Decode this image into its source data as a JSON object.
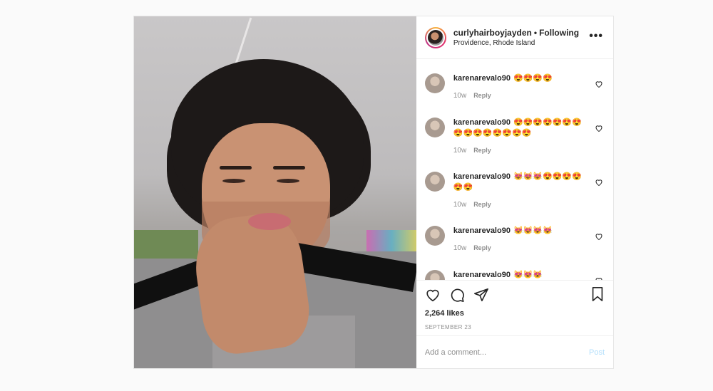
{
  "post": {
    "username": "curlyhairboyjayden",
    "separator": "•",
    "follow_status": "Following",
    "location": "Providence, Rhode Island",
    "more_icon": "more-horizontal-icon",
    "likes": "2,264 likes",
    "date": "SEPTEMBER 23",
    "add_comment_placeholder": "Add a comment...",
    "post_label": "Post"
  },
  "comments": [
    {
      "user": "karenarevalo90",
      "text": "😍😍😍😍",
      "age": "10w",
      "reply": "Reply"
    },
    {
      "user": "karenarevalo90",
      "text": "😍😍😍😍😍😍😍😍😍😍😍😍😍😍😍",
      "age": "10w",
      "reply": "Reply"
    },
    {
      "user": "karenarevalo90",
      "text": "😻😻😻😍😍😍😍😍😍",
      "age": "10w",
      "reply": "Reply"
    },
    {
      "user": "karenarevalo90",
      "text": "😻😻😻😻",
      "age": "10w",
      "reply": "Reply"
    },
    {
      "user": "karenarevalo90",
      "text": "😻😻😻",
      "age": "",
      "reply": ""
    }
  ],
  "colors": {
    "link_disabled": "#b2dffc",
    "muted": "#8e8e8e"
  }
}
